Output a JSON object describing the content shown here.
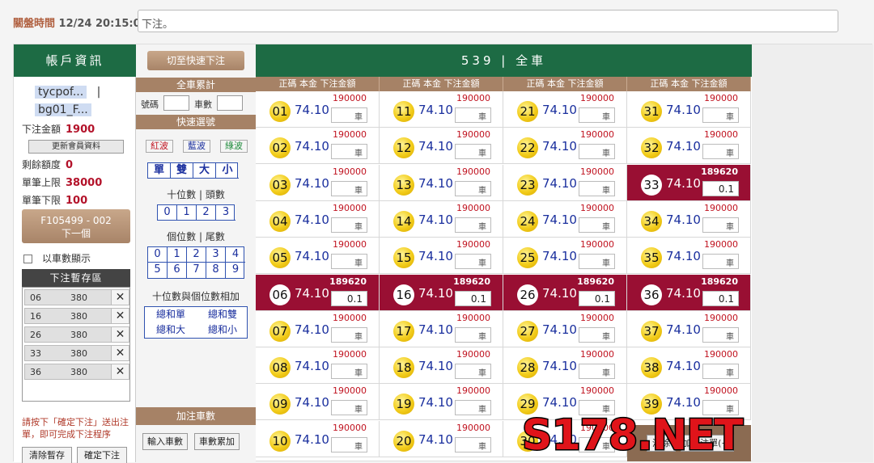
{
  "header": {
    "close_label": "關盤時間",
    "close_time": "12/24 20:15:00",
    "order_input_value": "下注。"
  },
  "account": {
    "title": "帳戶資訊",
    "user_line1": "tycpof...",
    "user_sep": "|",
    "user_line2": "bg01_F...",
    "bet_amount_label": "下注金額",
    "bet_amount": "1900",
    "update_button": "更新會員資料",
    "remaining_label": "剩餘額度",
    "remaining": "0",
    "max_label": "單筆上限",
    "max": "38000",
    "min_label": "單筆下限",
    "min": "100",
    "next_line1": "F105499 - 002",
    "next_line2": "下一個",
    "show_by_car_label": "以車數顯示",
    "temp_title": "下注暫存區",
    "temp_rows": [
      {
        "num": "06",
        "amount": "380",
        "remove": "✕"
      },
      {
        "num": "16",
        "amount": "380",
        "remove": "✕"
      },
      {
        "num": "26",
        "amount": "380",
        "remove": "✕"
      },
      {
        "num": "33",
        "amount": "380",
        "remove": "✕"
      },
      {
        "num": "36",
        "amount": "380",
        "remove": "✕"
      }
    ],
    "note": "請按下「確定下注」送出注單，即可完成下注程序",
    "clear_temp": "清除暫存",
    "confirm_bet": "確定下注"
  },
  "quick": {
    "switch_button": "切至快速下注",
    "full_car_title": "全車累計",
    "num_label": "號碼",
    "cars_label": "車數",
    "quick_select_title": "快速選號",
    "waves": [
      {
        "label": "紅波",
        "color": "#c0121f"
      },
      {
        "label": "藍波",
        "color": "#1a2f9e"
      },
      {
        "label": "綠波",
        "color": "#1d8a3a"
      }
    ],
    "odd_even_big_small": [
      "單",
      "雙",
      "大",
      "小"
    ],
    "tens_label": "十位數 | 頭數",
    "tens": [
      "0",
      "1",
      "2",
      "3"
    ],
    "units_label": "個位數 | 尾數",
    "units": [
      "0",
      "1",
      "2",
      "3",
      "4",
      "5",
      "6",
      "7",
      "8",
      "9"
    ],
    "sum_label": "十位數與個位數相加",
    "sum_options": [
      "總和單",
      "總和雙",
      "總和大",
      "總和小"
    ],
    "add_cars_title": "加注車數",
    "input_cars": "輸入車數",
    "cars_accumulate": "車數累加"
  },
  "main": {
    "title": "539 | 全車",
    "column_header": "正碼 本金 下注金額",
    "rate": "74.10",
    "default_limit": "190000",
    "selected_limit": "189620",
    "unit_placeholder": "車",
    "selected_value": "0.1",
    "numbers": [
      "01",
      "02",
      "03",
      "04",
      "05",
      "06",
      "07",
      "08",
      "09",
      "10",
      "11",
      "12",
      "13",
      "14",
      "15",
      "16",
      "17",
      "18",
      "19",
      "20",
      "21",
      "22",
      "23",
      "24",
      "25",
      "26",
      "27",
      "28",
      "29",
      "30",
      "31",
      "32",
      "33",
      "34",
      "35",
      "36",
      "37",
      "38",
      "39"
    ],
    "selected_numbers": [
      "06",
      "16",
      "26",
      "33",
      "36"
    ],
    "clear_button": "清除",
    "add_ticket_button": "加入注單(+)"
  },
  "watermark": "S178.NET"
}
